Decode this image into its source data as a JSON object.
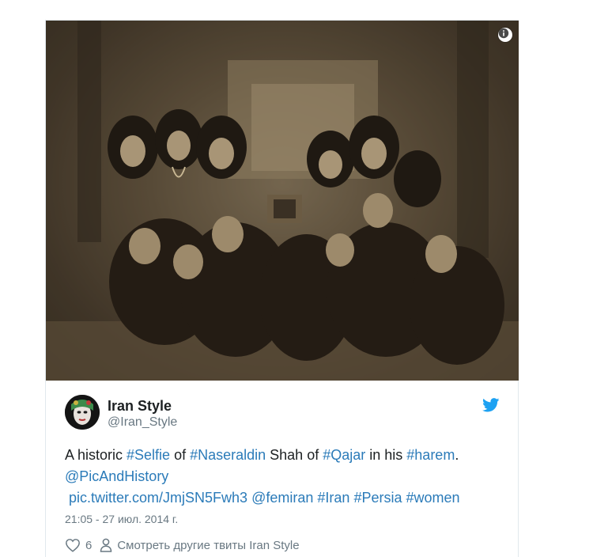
{
  "tweet": {
    "image": {
      "description_icon": "info-icon"
    },
    "author": {
      "name": "Iran Style",
      "handle": "@Iran_Style",
      "avatar_icon": "avatar-image"
    },
    "brand_icon": "twitter-bird-icon",
    "brand_color": "#1da1f2",
    "link_color": "#2b7bb9",
    "text": {
      "line1": {
        "t1": "A historic ",
        "h1": "#Selfie",
        "t2": " of ",
        "h2": "#Naseraldin",
        "t3": " Shah of ",
        "h3": "#Qajar",
        "t4": " in his ",
        "h4": "#harem",
        "t5": "."
      },
      "line2": {
        "mention": "@PicAndHistory"
      },
      "line3": {
        "pic": "pic.twitter.com/JmjSN5Fwh3",
        "mention": "@femiran",
        "h1": "#Iran",
        "h2": "#Persia",
        "h3": "#women"
      }
    },
    "timestamp": "21:05 - 27 июл. 2014 г.",
    "actions": {
      "like_icon": "heart-icon",
      "like_count": "6",
      "profile_icon": "person-icon",
      "more_tweets_label": "Смотреть другие твиты Iran Style"
    }
  }
}
